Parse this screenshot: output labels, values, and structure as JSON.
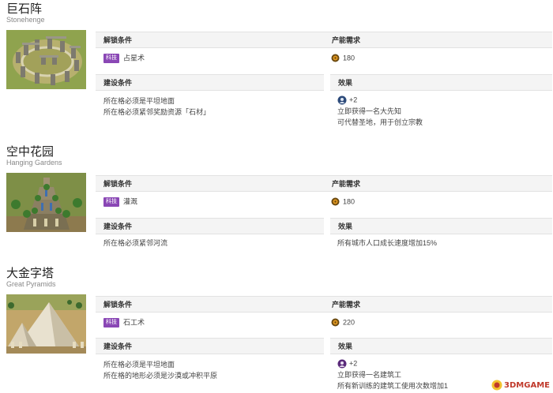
{
  "columns": {
    "unlock": "解锁条件",
    "production": "产能需求",
    "build": "建设条件",
    "effect": "效果"
  },
  "colors": {
    "badge": "#8a47b5",
    "header_bg": "#f4f4f4"
  },
  "icons": {
    "production": "production-gear-icon",
    "effect_prophet": "great-prophet-icon",
    "effect_engineer": "great-engineer-icon"
  },
  "wonders": [
    {
      "name_cn": "巨石阵",
      "name_en": "Stonehenge",
      "unlock_badge": "科技",
      "unlock_tech": "占星术",
      "production": "180",
      "build": [
        "所在格必须是平坦地面",
        "所在格必须紧邻奖励资源「石材」"
      ],
      "effect_value": "+2",
      "effect": [
        "立即获得一名大先知",
        "可代替圣地，用于创立宗教"
      ]
    },
    {
      "name_cn": "空中花园",
      "name_en": "Hanging Gardens",
      "unlock_badge": "科技",
      "unlock_tech": "灌溉",
      "production": "180",
      "build": [
        "所在格必须紧邻河流"
      ],
      "effect": [
        "所有城市人口成长速度增加15%"
      ]
    },
    {
      "name_cn": "大金字塔",
      "name_en": "Great Pyramids",
      "unlock_badge": "科技",
      "unlock_tech": "石工术",
      "production": "220",
      "build": [
        "所在格必须是平坦地面",
        "所在格的地形必须是沙漠或冲积平原"
      ],
      "effect_value": "+2",
      "effect": [
        "立即获得一名建筑工",
        "所有新训练的建筑工使用次数增加1"
      ]
    }
  ],
  "watermark": "3DMGAME"
}
